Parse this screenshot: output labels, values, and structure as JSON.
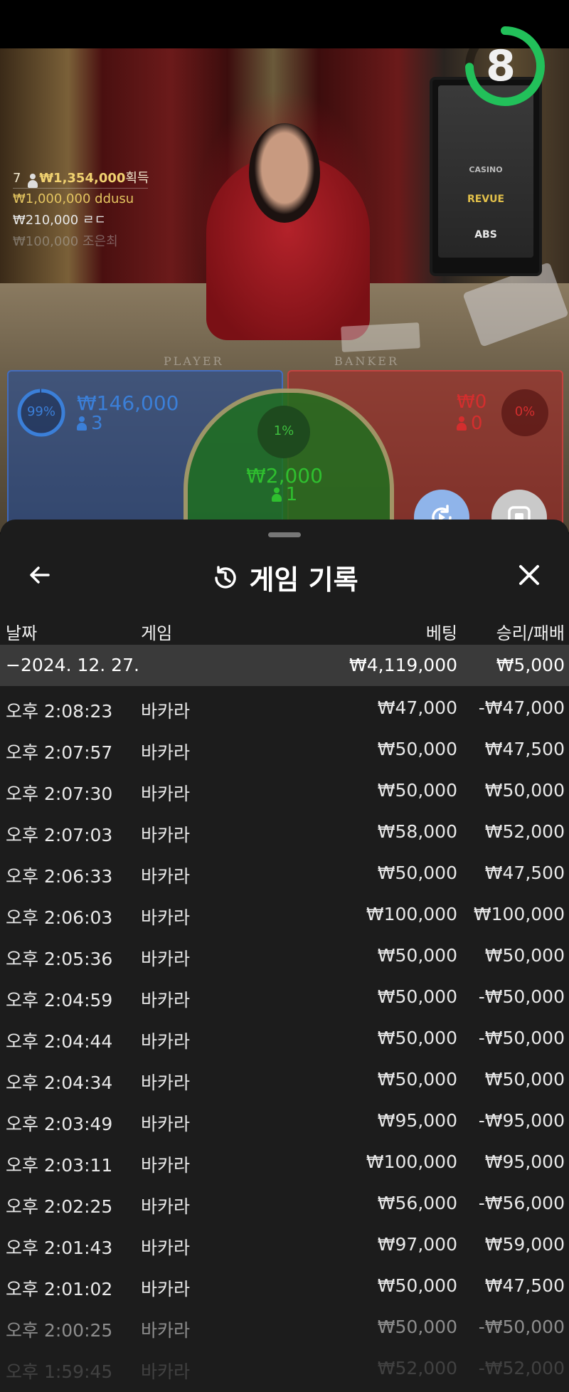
{
  "game_view": {
    "felt_player": "PLAYER",
    "felt_banker": "BANKER",
    "timer": "8",
    "monitor_brands": [
      "CASINO",
      "REVUE",
      "ABS"
    ],
    "winners": [
      {
        "rank": "7",
        "amount": "₩1,354,000",
        "label": "획득"
      },
      {
        "amount": "₩1,000,000",
        "name": "ddusu"
      },
      {
        "amount": "₩210,000",
        "name": "ㄹㄷ"
      },
      {
        "amount": "₩100,000",
        "name": "조은최"
      }
    ],
    "bets": {
      "player": {
        "percent": "99%",
        "percent_value": 99,
        "amount": "₩146,000",
        "count": "3",
        "color": "#3b7fd8"
      },
      "tie": {
        "percent": "1%",
        "percent_value": 1,
        "amount": "₩2,000",
        "count": "1",
        "color": "#2fbf2f"
      },
      "banker": {
        "percent": "0%",
        "percent_value": 0,
        "amount": "₩0",
        "count": "0",
        "color": "#d42e2e"
      }
    }
  },
  "history": {
    "title": "게임 기록",
    "columns": {
      "date": "날짜",
      "game": "게임",
      "bet": "베팅",
      "win_loss": "승리/패배"
    },
    "group": {
      "date": "−2024. 12. 27.",
      "bet": "₩4,119,000",
      "win_loss": "₩5,000"
    },
    "rows": [
      {
        "time": "오후 2:08:23",
        "game": "바카라",
        "bet": "₩47,000",
        "result": "-₩47,000"
      },
      {
        "time": "오후 2:07:57",
        "game": "바카라",
        "bet": "₩50,000",
        "result": "₩47,500"
      },
      {
        "time": "오후 2:07:30",
        "game": "바카라",
        "bet": "₩50,000",
        "result": "₩50,000"
      },
      {
        "time": "오후 2:07:03",
        "game": "바카라",
        "bet": "₩58,000",
        "result": "₩52,000"
      },
      {
        "time": "오후 2:06:33",
        "game": "바카라",
        "bet": "₩50,000",
        "result": "₩47,500"
      },
      {
        "time": "오후 2:06:03",
        "game": "바카라",
        "bet": "₩100,000",
        "result": "₩100,000"
      },
      {
        "time": "오후 2:05:36",
        "game": "바카라",
        "bet": "₩50,000",
        "result": "₩50,000"
      },
      {
        "time": "오후 2:04:59",
        "game": "바카라",
        "bet": "₩50,000",
        "result": "-₩50,000"
      },
      {
        "time": "오후 2:04:44",
        "game": "바카라",
        "bet": "₩50,000",
        "result": "-₩50,000"
      },
      {
        "time": "오후 2:04:34",
        "game": "바카라",
        "bet": "₩50,000",
        "result": "₩50,000"
      },
      {
        "time": "오후 2:03:49",
        "game": "바카라",
        "bet": "₩95,000",
        "result": "-₩95,000"
      },
      {
        "time": "오후 2:03:11",
        "game": "바카라",
        "bet": "₩100,000",
        "result": "₩95,000"
      },
      {
        "time": "오후 2:02:25",
        "game": "바카라",
        "bet": "₩56,000",
        "result": "-₩56,000"
      },
      {
        "time": "오후 2:01:43",
        "game": "바카라",
        "bet": "₩97,000",
        "result": "₩59,000"
      },
      {
        "time": "오후 2:01:02",
        "game": "바카라",
        "bet": "₩50,000",
        "result": "₩47,500"
      },
      {
        "time": "오후 2:00:25",
        "game": "바카라",
        "bet": "₩50,000",
        "result": "-₩50,000"
      },
      {
        "time": "오후 1:59:45",
        "game": "바카라",
        "bet": "₩52,000",
        "result": "-₩52,000"
      }
    ]
  },
  "icons": {
    "back": "arrow-left-icon",
    "history": "history-icon",
    "close": "close-icon",
    "replay": "replay-icon",
    "stop": "stop-icon"
  }
}
